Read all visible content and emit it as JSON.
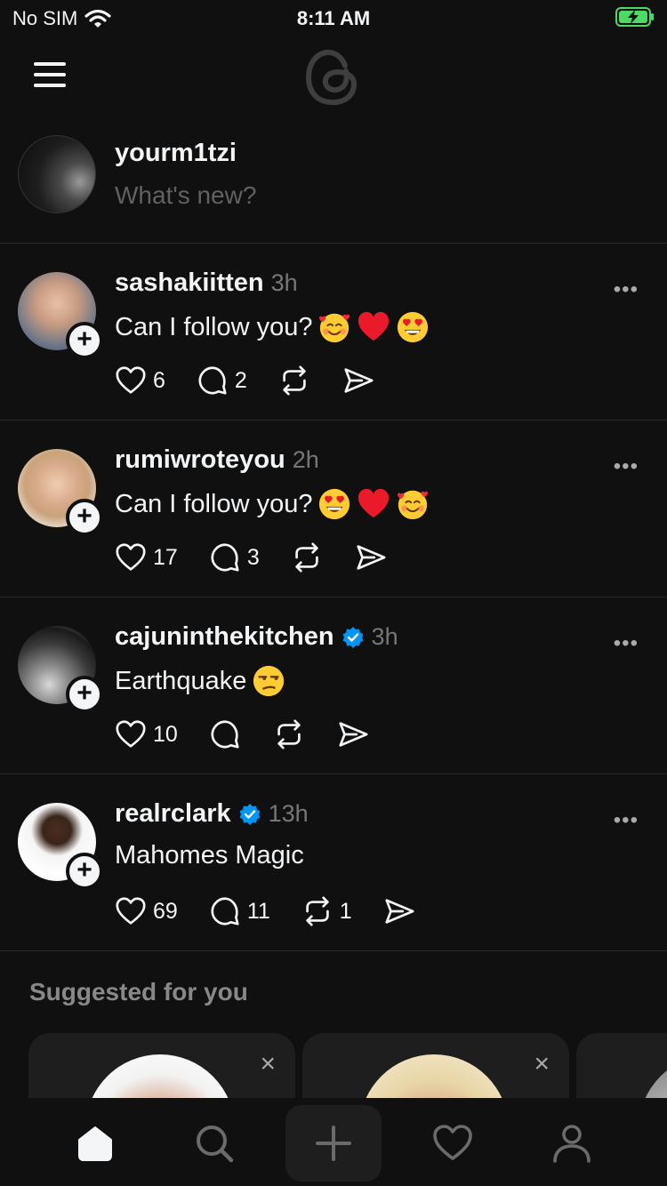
{
  "status_bar": {
    "carrier": "No SIM",
    "time": "8:11 AM"
  },
  "composer": {
    "username": "yourm1tzi",
    "placeholder": "What's new?"
  },
  "posts": [
    {
      "username": "sashakiitten",
      "time": "3h",
      "verified": false,
      "text": "Can I follow you?",
      "emojis": [
        "smiling-face-with-hearts",
        "red-heart",
        "heart-eyes"
      ],
      "likes": "6",
      "replies": "2",
      "reposts": ""
    },
    {
      "username": "rumiwroteyou",
      "time": "2h",
      "verified": false,
      "text": "Can I follow you?",
      "emojis": [
        "heart-eyes",
        "red-heart",
        "smiling-face-with-hearts"
      ],
      "likes": "17",
      "replies": "3",
      "reposts": ""
    },
    {
      "username": "cajuninthekitchen",
      "time": "3h",
      "verified": true,
      "text": "Earthquake",
      "emojis": [
        "unamused-face"
      ],
      "likes": "10",
      "replies": "",
      "reposts": ""
    },
    {
      "username": "realrclark",
      "time": "13h",
      "verified": true,
      "text": "Mahomes Magic",
      "emojis": [],
      "likes": "69",
      "replies": "11",
      "reposts": "1"
    }
  ],
  "more_label": "•••",
  "follow_label": "+",
  "suggested": {
    "title": "Suggested for you",
    "close_label": "×"
  },
  "tabs": [
    "home-icon",
    "search-icon",
    "new-thread-icon",
    "activity-heart-icon",
    "profile-icon"
  ],
  "colors": {
    "background": "#101010",
    "verified": "#0095f6",
    "muted": "#777777"
  }
}
